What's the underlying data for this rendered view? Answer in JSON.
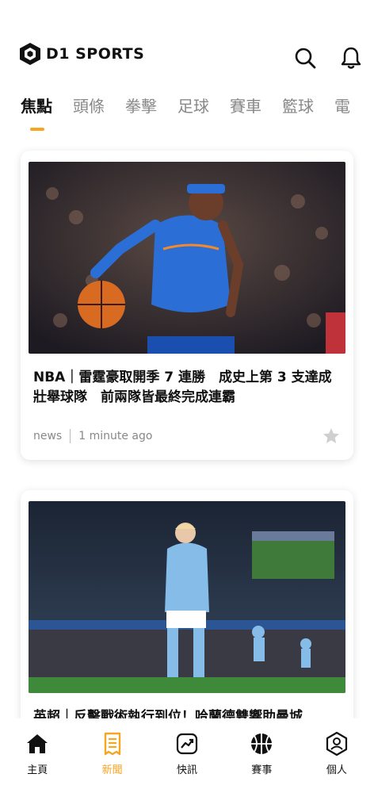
{
  "app": {
    "brand": "D1 SPORTS"
  },
  "header": {
    "search_icon": "search-icon",
    "bell_icon": "bell-icon"
  },
  "tabs": [
    {
      "label": "焦點",
      "active": true
    },
    {
      "label": "頭條"
    },
    {
      "label": "拳擊"
    },
    {
      "label": "足球"
    },
    {
      "label": "賽車"
    },
    {
      "label": "籃球"
    },
    {
      "label": "電"
    }
  ],
  "articles": [
    {
      "title": "NBA｜雷霆豪取開季 7 連勝　成史上第 3 支達成壯舉球隊　前兩隊皆最終完成連霸",
      "category": "news",
      "time": "1 minute ago",
      "image": "basketball-player-photo"
    },
    {
      "title": "英超｜反擊戰術執行到位！哈蘭德雙響助曼城",
      "image": "football-match-photo"
    }
  ],
  "bottom_nav": [
    {
      "label": "主頁",
      "icon": "home-icon"
    },
    {
      "label": "新聞",
      "icon": "news-icon",
      "active": true
    },
    {
      "label": "快訊",
      "icon": "flash-icon"
    },
    {
      "label": "賽事",
      "icon": "basketball-icon"
    },
    {
      "label": "個人",
      "icon": "profile-icon"
    }
  ],
  "colors": {
    "accent": "#f5a623",
    "text": "#111111",
    "muted": "#888888"
  }
}
